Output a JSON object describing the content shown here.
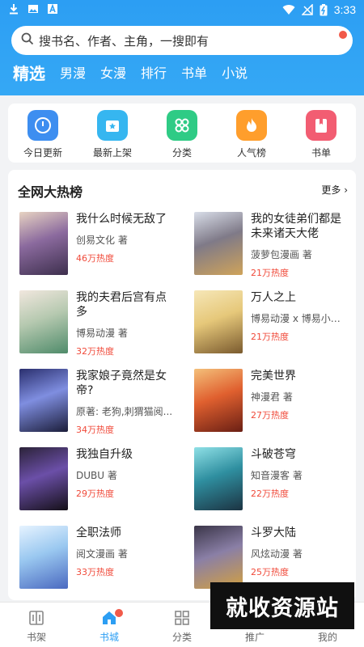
{
  "status_bar": {
    "time": "3:33"
  },
  "search": {
    "placeholder": "搜书名、作者、主角，一搜即有"
  },
  "tabs": [
    {
      "label": "精选",
      "active": true
    },
    {
      "label": "男漫"
    },
    {
      "label": "女漫"
    },
    {
      "label": "排行"
    },
    {
      "label": "书单"
    },
    {
      "label": "小说"
    }
  ],
  "quick": [
    {
      "label": "今日更新",
      "icon": "clock-icon",
      "color": "#3d8ef0"
    },
    {
      "label": "最新上架",
      "icon": "new-shelf-icon",
      "color": "#36b6f0"
    },
    {
      "label": "分类",
      "icon": "category-icon",
      "color": "#2fcb85"
    },
    {
      "label": "人气榜",
      "icon": "flame-icon",
      "color": "#ff9e2c"
    },
    {
      "label": "书单",
      "icon": "bookmark-icon",
      "color": "#f25d72"
    }
  ],
  "hot": {
    "title": "全网大热榜",
    "more": "更多",
    "items": [
      {
        "title": "我什么时候无敌了",
        "author": "创易文化 著",
        "heat": "46万热度"
      },
      {
        "title": "我的女徒弟们都是未来诸天大佬",
        "author": "菠萝包漫画 著",
        "heat": "21万热度"
      },
      {
        "title": "我的夫君后宫有点多",
        "author": "博易动漫 著",
        "heat": "32万热度"
      },
      {
        "title": "万人之上",
        "author": "博易动漫 x 博易小助...",
        "heat": "21万热度"
      },
      {
        "title": "我家娘子竟然是女帝?",
        "author": "原著: 老狗,刺猬猫阅...",
        "heat": "34万热度"
      },
      {
        "title": "完美世界",
        "author": "神漫君 著",
        "heat": "27万热度"
      },
      {
        "title": "我独自升级",
        "author": "DUBU 著",
        "heat": "29万热度"
      },
      {
        "title": "斗破苍穹",
        "author": "知音漫客 著",
        "heat": "22万热度"
      },
      {
        "title": "全职法师",
        "author": "阅文漫画 著",
        "heat": "33万热度"
      },
      {
        "title": "斗罗大陆",
        "author": "风炫动漫 著",
        "heat": "25万热度"
      }
    ]
  },
  "bottom_nav": [
    {
      "label": "书架",
      "icon": "bookshelf-icon"
    },
    {
      "label": "书城",
      "icon": "home-icon",
      "active": true
    },
    {
      "label": "分类",
      "icon": "grid-icon"
    },
    {
      "label": "推广",
      "icon": "promo-icon"
    },
    {
      "label": "我的",
      "icon": "profile-icon"
    }
  ],
  "watermark": "就收资源站",
  "colors": {
    "brand": "#2c9ef3",
    "heat": "#f04a3a",
    "badge": "#f15a4a"
  }
}
